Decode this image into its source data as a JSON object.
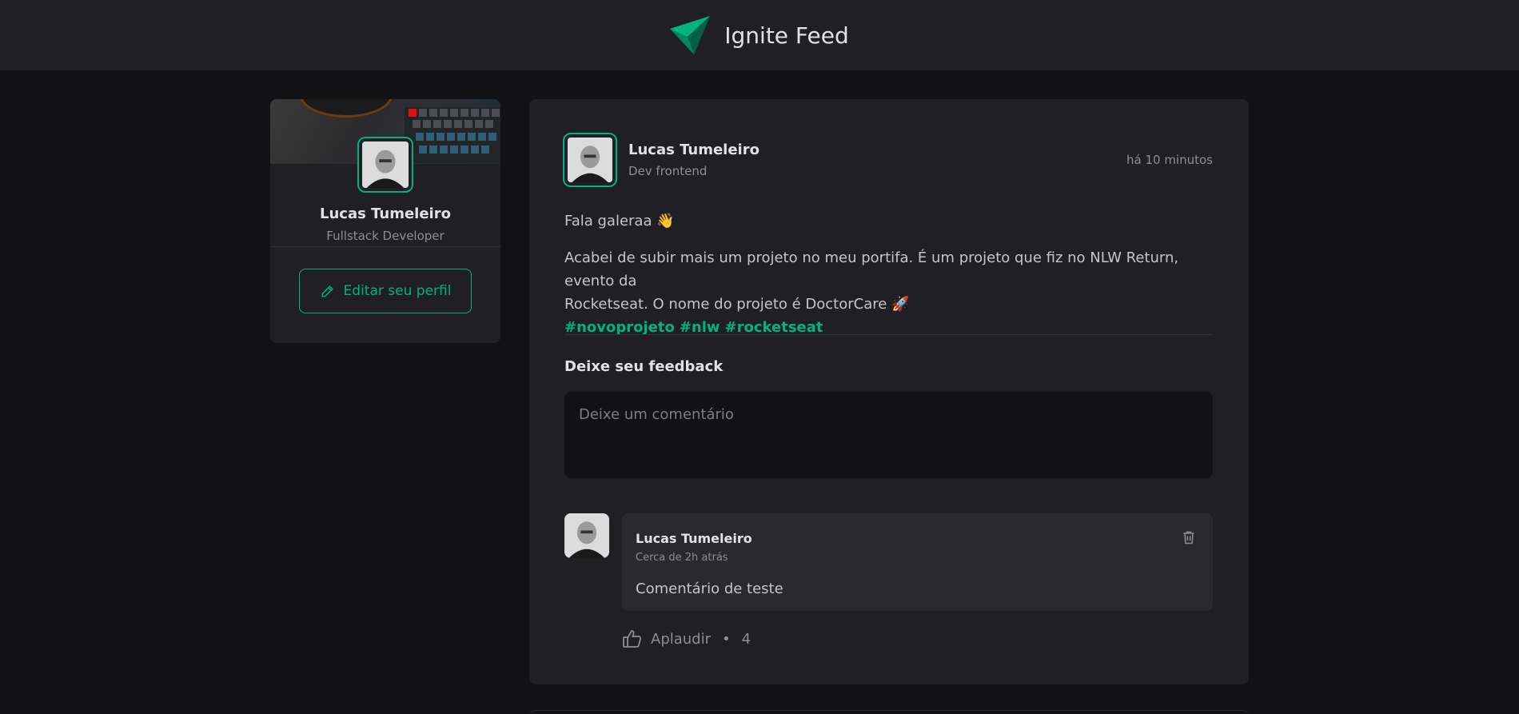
{
  "header": {
    "title": "Ignite Feed",
    "logo_icon": "paper-plane-logo-icon"
  },
  "sidebar": {
    "cover_image": "keyboard-cover-image",
    "profile_name": "Lucas Tumeleiro",
    "profile_role": "Fullstack Developer",
    "edit_button_label": "Editar seu perfil",
    "edit_icon": "pencil-icon"
  },
  "post": {
    "author_name": "Lucas Tumeleiro",
    "author_role": "Dev frontend",
    "time": "há 10 minutos",
    "greeting": "Fala galeraa 👋",
    "body_line1": "Acabei de subir mais um projeto no meu portifa. É um projeto que fiz no NLW Return, evento da",
    "body_line2": "Rocketseat. O nome do projeto é DoctorCare 🚀",
    "hashtags": [
      "#novoprojeto",
      "#nlw",
      "#rocketseat"
    ],
    "feedback_title": "Deixe seu feedback",
    "comment_placeholder": "Deixe um comentário"
  },
  "comment": {
    "author_name": "Lucas Tumeleiro",
    "time": "Cerca de 2h atrás",
    "text": "Comentário de teste",
    "delete_icon": "trash-icon",
    "applaud_label": "Aplaudir",
    "applaud_separator": "•",
    "applaud_count": "4",
    "applaud_icon": "thumbs-up-icon"
  },
  "colors": {
    "brand": "#00b37e",
    "background": "#121214",
    "surface": "#202024",
    "comment_surface": "#29292e"
  }
}
